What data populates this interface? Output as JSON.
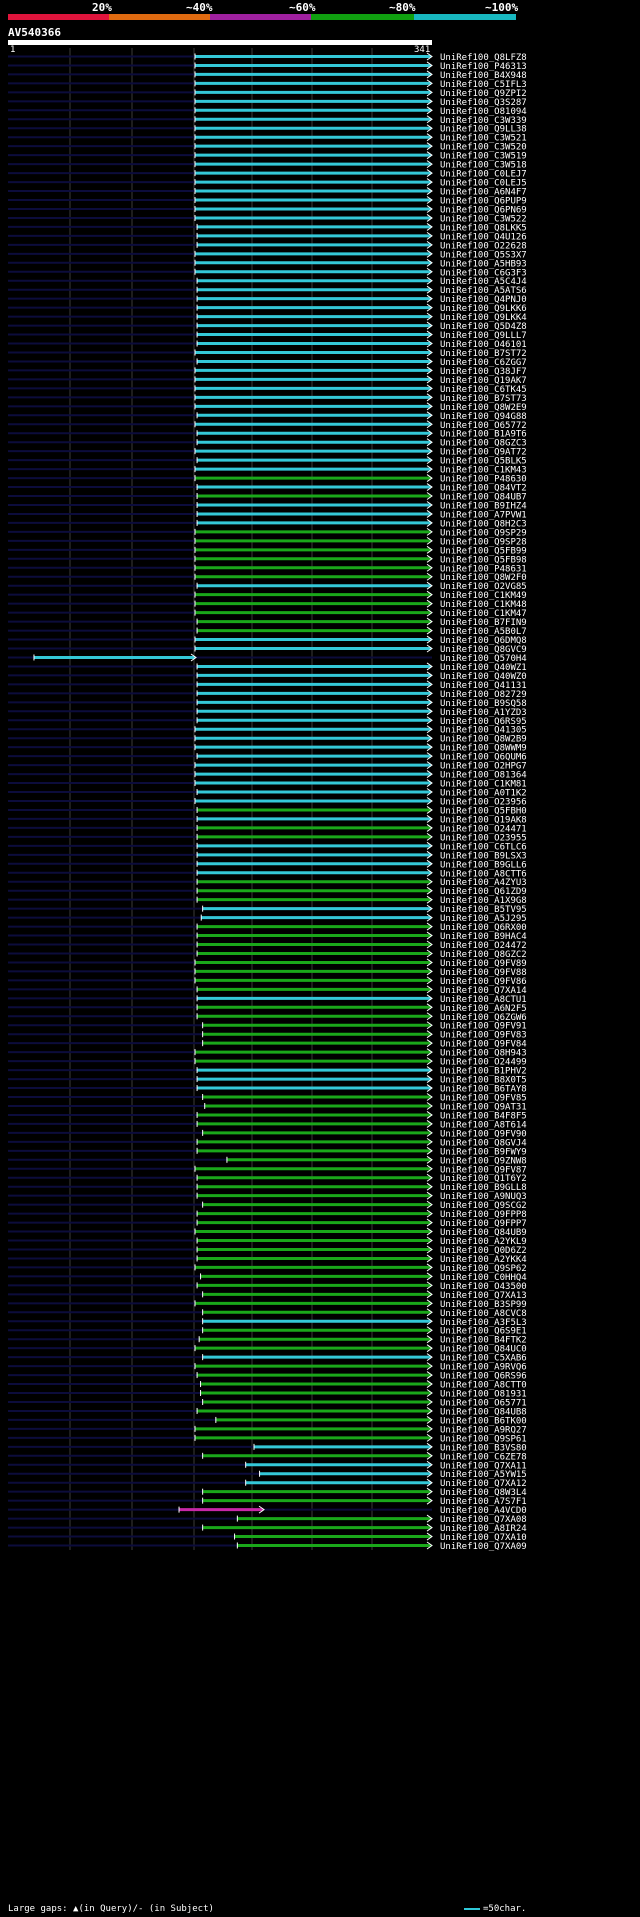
{
  "header": {
    "percent_labels": [
      "20%",
      "~40%",
      "~60%",
      "~80%",
      "~100%"
    ],
    "identity_colors": [
      "#e0143c",
      "#e06a10",
      "#a020a0",
      "#10a010",
      "#18b8c0"
    ],
    "query_id": "AV540366",
    "query_start_label": "1",
    "query_end_label": "341"
  },
  "footer": {
    "gaps_legend": "Large gaps: ▲(in Query)/- (in Subject)",
    "scale_label": "=50char."
  },
  "chart_data": {
    "type": "alignment",
    "query_length": 341,
    "colors": {
      "cyan": "#34c8d8",
      "green": "#1aa81a",
      "magenta": "#c828a8"
    },
    "hits": [
      {
        "id": "UniRef100_Q8LFZ8",
        "start": 1,
        "end": 341,
        "color": "cyan"
      },
      {
        "id": "UniRef100_P46313",
        "start": 1,
        "end": 341,
        "color": "cyan"
      },
      {
        "id": "UniRef100_B4X948",
        "start": 1,
        "end": 341,
        "color": "cyan"
      },
      {
        "id": "UniRef100_C5IFL3",
        "start": 1,
        "end": 341,
        "color": "cyan"
      },
      {
        "id": "UniRef100_Q9ZPI2",
        "start": 1,
        "end": 341,
        "color": "cyan"
      },
      {
        "id": "UniRef100_Q3S287",
        "start": 1,
        "end": 341,
        "color": "cyan"
      },
      {
        "id": "UniRef100_O81094",
        "start": 1,
        "end": 341,
        "color": "cyan"
      },
      {
        "id": "UniRef100_C3W339",
        "start": 1,
        "end": 341,
        "color": "cyan"
      },
      {
        "id": "UniRef100_Q9LL38",
        "start": 1,
        "end": 341,
        "color": "cyan"
      },
      {
        "id": "UniRef100_C3W521",
        "start": 1,
        "end": 341,
        "color": "cyan"
      },
      {
        "id": "UniRef100_C3W520",
        "start": 1,
        "end": 341,
        "color": "cyan"
      },
      {
        "id": "UniRef100_C3W519",
        "start": 1,
        "end": 341,
        "color": "cyan"
      },
      {
        "id": "UniRef100_C3W518",
        "start": 1,
        "end": 341,
        "color": "cyan"
      },
      {
        "id": "UniRef100_C0LEJ7",
        "start": 1,
        "end": 341,
        "color": "cyan"
      },
      {
        "id": "UniRef100_C0LEJ5",
        "start": 1,
        "end": 341,
        "color": "cyan"
      },
      {
        "id": "UniRef100_A6N4F7",
        "start": 1,
        "end": 341,
        "color": "cyan"
      },
      {
        "id": "UniRef100_Q6PUP9",
        "start": 1,
        "end": 341,
        "color": "cyan"
      },
      {
        "id": "UniRef100_Q6PN69",
        "start": 1,
        "end": 341,
        "color": "cyan"
      },
      {
        "id": "UniRef100_C3W522",
        "start": 1,
        "end": 341,
        "color": "cyan"
      },
      {
        "id": "UniRef100_Q8LKK5",
        "start": 4,
        "end": 341,
        "color": "cyan"
      },
      {
        "id": "UniRef100_Q4U126",
        "start": 4,
        "end": 341,
        "color": "cyan"
      },
      {
        "id": "UniRef100_O22628",
        "start": 4,
        "end": 341,
        "color": "cyan"
      },
      {
        "id": "UniRef100_Q5S3X7",
        "start": 1,
        "end": 341,
        "color": "cyan"
      },
      {
        "id": "UniRef100_A5HB93",
        "start": 1,
        "end": 341,
        "color": "cyan"
      },
      {
        "id": "UniRef100_C6G3F3",
        "start": 1,
        "end": 341,
        "color": "cyan"
      },
      {
        "id": "UniRef100_A5C4J4",
        "start": 4,
        "end": 341,
        "color": "cyan"
      },
      {
        "id": "UniRef100_A5ATS6",
        "start": 4,
        "end": 341,
        "color": "cyan"
      },
      {
        "id": "UniRef100_Q4PNJ0",
        "start": 4,
        "end": 341,
        "color": "cyan"
      },
      {
        "id": "UniRef100_Q9LKK6",
        "start": 4,
        "end": 341,
        "color": "cyan"
      },
      {
        "id": "UniRef100_Q9LKK4",
        "start": 4,
        "end": 341,
        "color": "cyan"
      },
      {
        "id": "UniRef100_Q5D4Z8",
        "start": 4,
        "end": 341,
        "color": "cyan"
      },
      {
        "id": "UniRef100_Q9LLL7",
        "start": 4,
        "end": 341,
        "color": "cyan"
      },
      {
        "id": "UniRef100_O46101",
        "start": 4,
        "end": 341,
        "color": "cyan"
      },
      {
        "id": "UniRef100_B7ST72",
        "start": 1,
        "end": 341,
        "color": "cyan"
      },
      {
        "id": "UniRef100_C6ZGG7",
        "start": 4,
        "end": 341,
        "color": "cyan"
      },
      {
        "id": "UniRef100_Q38JF7",
        "start": 1,
        "end": 341,
        "color": "cyan"
      },
      {
        "id": "UniRef100_Q19AK7",
        "start": 1,
        "end": 341,
        "color": "cyan"
      },
      {
        "id": "UniRef100_C6TK45",
        "start": 1,
        "end": 341,
        "color": "cyan"
      },
      {
        "id": "UniRef100_B7ST73",
        "start": 1,
        "end": 341,
        "color": "cyan"
      },
      {
        "id": "UniRef100_Q8W2E9",
        "start": 1,
        "end": 341,
        "color": "cyan"
      },
      {
        "id": "UniRef100_Q94G88",
        "start": 4,
        "end": 341,
        "color": "cyan"
      },
      {
        "id": "UniRef100_O65772",
        "start": 1,
        "end": 341,
        "color": "cyan"
      },
      {
        "id": "UniRef100_B1A9T6",
        "start": 4,
        "end": 341,
        "color": "cyan"
      },
      {
        "id": "UniRef100_Q8GZC3",
        "start": 4,
        "end": 341,
        "color": "cyan"
      },
      {
        "id": "UniRef100_Q9AT72",
        "start": 1,
        "end": 341,
        "color": "cyan"
      },
      {
        "id": "UniRef100_Q5BLK5",
        "start": 4,
        "end": 341,
        "color": "cyan"
      },
      {
        "id": "UniRef100_C1KM43",
        "start": 1,
        "end": 341,
        "color": "cyan"
      },
      {
        "id": "UniRef100_P48630",
        "start": 1,
        "end": 341,
        "color": "green"
      },
      {
        "id": "UniRef100_Q84VT2",
        "start": 4,
        "end": 341,
        "color": "cyan"
      },
      {
        "id": "UniRef100_Q84UB7",
        "start": 4,
        "end": 341,
        "color": "green"
      },
      {
        "id": "UniRef100_B9IHZ4",
        "start": 4,
        "end": 341,
        "color": "cyan"
      },
      {
        "id": "UniRef100_A7PVW1",
        "start": 4,
        "end": 341,
        "color": "cyan"
      },
      {
        "id": "UniRef100_Q8H2C3",
        "start": 4,
        "end": 341,
        "color": "cyan"
      },
      {
        "id": "UniRef100_Q9SP29",
        "start": 1,
        "end": 341,
        "color": "green"
      },
      {
        "id": "UniRef100_Q9SP28",
        "start": 1,
        "end": 341,
        "color": "green"
      },
      {
        "id": "UniRef100_Q5FB99",
        "start": 1,
        "end": 341,
        "color": "green"
      },
      {
        "id": "UniRef100_Q5FB98",
        "start": 1,
        "end": 341,
        "color": "green"
      },
      {
        "id": "UniRef100_P48631",
        "start": 1,
        "end": 341,
        "color": "green"
      },
      {
        "id": "UniRef100_Q8W2F0",
        "start": 1,
        "end": 341,
        "color": "green"
      },
      {
        "id": "UniRef100_O2VG85",
        "start": 4,
        "end": 341,
        "color": "cyan"
      },
      {
        "id": "UniRef100_C1KM49",
        "start": 1,
        "end": 341,
        "color": "green"
      },
      {
        "id": "UniRef100_C1KM48",
        "start": 1,
        "end": 341,
        "color": "green"
      },
      {
        "id": "UniRef100_C1KM47",
        "start": 1,
        "end": 341,
        "color": "green"
      },
      {
        "id": "UniRef100_B7FIN9",
        "start": 4,
        "end": 341,
        "color": "green"
      },
      {
        "id": "UniRef100_A5B0L7",
        "start": 4,
        "end": 341,
        "color": "green"
      },
      {
        "id": "UniRef100_Q6DMQ8",
        "start": 1,
        "end": 341,
        "color": "cyan"
      },
      {
        "id": "UniRef100_Q8GVC9",
        "start": 1,
        "end": 341,
        "color": "cyan"
      },
      {
        "id": "UniRef100_Q570H4",
        "start": -231,
        "end": 1,
        "color": "cyan"
      },
      {
        "id": "UniRef100_Q40WZ1",
        "start": 4,
        "end": 341,
        "color": "cyan"
      },
      {
        "id": "UniRef100_Q40WZ0",
        "start": 4,
        "end": 341,
        "color": "cyan"
      },
      {
        "id": "UniRef100_Q41131",
        "start": 4,
        "end": 341,
        "color": "cyan"
      },
      {
        "id": "UniRef100_O82729",
        "start": 4,
        "end": 341,
        "color": "cyan"
      },
      {
        "id": "UniRef100_B9SQ58",
        "start": 4,
        "end": 341,
        "color": "cyan"
      },
      {
        "id": "UniRef100_A1YZD3",
        "start": 4,
        "end": 341,
        "color": "cyan"
      },
      {
        "id": "UniRef100_Q6RS95",
        "start": 4,
        "end": 341,
        "color": "cyan"
      },
      {
        "id": "UniRef100_Q41305",
        "start": 1,
        "end": 341,
        "color": "cyan"
      },
      {
        "id": "UniRef100_Q8W2B9",
        "start": 1,
        "end": 341,
        "color": "cyan"
      },
      {
        "id": "UniRef100_Q8WWM9",
        "start": 1,
        "end": 341,
        "color": "cyan"
      },
      {
        "id": "UniRef100_Q6QUM6",
        "start": 4,
        "end": 341,
        "color": "cyan"
      },
      {
        "id": "UniRef100_O2HPG7",
        "start": 1,
        "end": 341,
        "color": "cyan"
      },
      {
        "id": "UniRef100_O81364",
        "start": 1,
        "end": 341,
        "color": "cyan"
      },
      {
        "id": "UniRef100_C1KM81",
        "start": 1,
        "end": 341,
        "color": "cyan"
      },
      {
        "id": "UniRef100_A0T1K2",
        "start": 4,
        "end": 341,
        "color": "cyan"
      },
      {
        "id": "UniRef100_O23956",
        "start": 1,
        "end": 341,
        "color": "cyan"
      },
      {
        "id": "UniRef100_Q5FBH0",
        "start": 4,
        "end": 341,
        "color": "green"
      },
      {
        "id": "UniRef100_Q19AK8",
        "start": 4,
        "end": 341,
        "color": "cyan"
      },
      {
        "id": "UniRef100_O24471",
        "start": 4,
        "end": 341,
        "color": "green"
      },
      {
        "id": "UniRef100_O23955",
        "start": 4,
        "end": 341,
        "color": "green"
      },
      {
        "id": "UniRef100_C6TLC6",
        "start": 4,
        "end": 341,
        "color": "cyan"
      },
      {
        "id": "UniRef100_B9LSX3",
        "start": 4,
        "end": 341,
        "color": "cyan"
      },
      {
        "id": "UniRef100_B9GLL6",
        "start": 4,
        "end": 341,
        "color": "cyan"
      },
      {
        "id": "UniRef100_A8CTT6",
        "start": 4,
        "end": 341,
        "color": "cyan"
      },
      {
        "id": "UniRef100_A4ZYU3",
        "start": 4,
        "end": 341,
        "color": "green"
      },
      {
        "id": "UniRef100_Q61ZD9",
        "start": 4,
        "end": 341,
        "color": "green"
      },
      {
        "id": "UniRef100_A1X9G8",
        "start": 4,
        "end": 341,
        "color": "green"
      },
      {
        "id": "UniRef100_B5TV95",
        "start": 12,
        "end": 341,
        "color": "cyan"
      },
      {
        "id": "UniRef100_A5J295",
        "start": 10,
        "end": 341,
        "color": "cyan"
      },
      {
        "id": "UniRef100_Q6RX00",
        "start": 4,
        "end": 341,
        "color": "green"
      },
      {
        "id": "UniRef100_B9HAC4",
        "start": 4,
        "end": 341,
        "color": "green"
      },
      {
        "id": "UniRef100_O24472",
        "start": 4,
        "end": 341,
        "color": "green"
      },
      {
        "id": "UniRef100_Q8GZC2",
        "start": 4,
        "end": 341,
        "color": "green"
      },
      {
        "id": "UniRef100_Q9FV89",
        "start": 1,
        "end": 341,
        "color": "green"
      },
      {
        "id": "UniRef100_Q9FV88",
        "start": 1,
        "end": 341,
        "color": "green"
      },
      {
        "id": "UniRef100_Q9FV86",
        "start": 1,
        "end": 341,
        "color": "green"
      },
      {
        "id": "UniRef100_Q7XA14",
        "start": 4,
        "end": 341,
        "color": "green"
      },
      {
        "id": "UniRef100_A8CTU1",
        "start": 4,
        "end": 341,
        "color": "cyan"
      },
      {
        "id": "UniRef100_A6N2F5",
        "start": 4,
        "end": 341,
        "color": "green"
      },
      {
        "id": "UniRef100_Q6ZGW6",
        "start": 4,
        "end": 341,
        "color": "green"
      },
      {
        "id": "UniRef100_Q9FV91",
        "start": 12,
        "end": 341,
        "color": "green"
      },
      {
        "id": "UniRef100_Q9FV83",
        "start": 12,
        "end": 341,
        "color": "green"
      },
      {
        "id": "UniRef100_Q9FV84",
        "start": 12,
        "end": 341,
        "color": "green"
      },
      {
        "id": "UniRef100_Q8H943",
        "start": 1,
        "end": 341,
        "color": "green"
      },
      {
        "id": "UniRef100_O24499",
        "start": 1,
        "end": 341,
        "color": "green"
      },
      {
        "id": "UniRef100_B1PHV2",
        "start": 4,
        "end": 341,
        "color": "cyan"
      },
      {
        "id": "UniRef100_B8X0T5",
        "start": 4,
        "end": 341,
        "color": "cyan"
      },
      {
        "id": "UniRef100_B6TAY8",
        "start": 4,
        "end": 341,
        "color": "cyan"
      },
      {
        "id": "UniRef100_Q9FV85",
        "start": 12,
        "end": 341,
        "color": "green"
      },
      {
        "id": "UniRef100_Q9AT31",
        "start": 15,
        "end": 341,
        "color": "green"
      },
      {
        "id": "UniRef100_B4F8F5",
        "start": 4,
        "end": 341,
        "color": "green"
      },
      {
        "id": "UniRef100_A8T614",
        "start": 4,
        "end": 341,
        "color": "green"
      },
      {
        "id": "UniRef100_Q9FV90",
        "start": 12,
        "end": 341,
        "color": "green"
      },
      {
        "id": "UniRef100_Q8GVJ4",
        "start": 4,
        "end": 341,
        "color": "green"
      },
      {
        "id": "UniRef100_B9FWY9",
        "start": 4,
        "end": 341,
        "color": "green"
      },
      {
        "id": "UniRef100_Q9ZNW8",
        "start": 47,
        "end": 341,
        "color": "green"
      },
      {
        "id": "UniRef100_Q9FV87",
        "start": 1,
        "end": 341,
        "color": "green"
      },
      {
        "id": "UniRef100_Q1T6Y2",
        "start": 4,
        "end": 341,
        "color": "green"
      },
      {
        "id": "UniRef100_B9GLL8",
        "start": 4,
        "end": 341,
        "color": "green"
      },
      {
        "id": "UniRef100_A9NUQ3",
        "start": 4,
        "end": 341,
        "color": "green"
      },
      {
        "id": "UniRef100_Q9SCG2",
        "start": 12,
        "end": 341,
        "color": "green"
      },
      {
        "id": "UniRef100_Q9FPP8",
        "start": 4,
        "end": 341,
        "color": "green"
      },
      {
        "id": "UniRef100_Q9FPP7",
        "start": 4,
        "end": 341,
        "color": "green"
      },
      {
        "id": "UniRef100_Q84UB9",
        "start": 1,
        "end": 341,
        "color": "green"
      },
      {
        "id": "UniRef100_A2YKL9",
        "start": 4,
        "end": 341,
        "color": "green"
      },
      {
        "id": "UniRef100_Q0D6Z2",
        "start": 4,
        "end": 341,
        "color": "green"
      },
      {
        "id": "UniRef100_A2YKK4",
        "start": 4,
        "end": 341,
        "color": "green"
      },
      {
        "id": "UniRef100_Q9SP62",
        "start": 1,
        "end": 341,
        "color": "green"
      },
      {
        "id": "UniRef100_C0HHQ4",
        "start": 9,
        "end": 341,
        "color": "green"
      },
      {
        "id": "UniRef100_O43500",
        "start": 4,
        "end": 341,
        "color": "green"
      },
      {
        "id": "UniRef100_Q7XA13",
        "start": 12,
        "end": 341,
        "color": "green"
      },
      {
        "id": "UniRef100_B3SP99",
        "start": 1,
        "end": 341,
        "color": "green"
      },
      {
        "id": "UniRef100_A8CVC8",
        "start": 12,
        "end": 341,
        "color": "green"
      },
      {
        "id": "UniRef100_A3F5L3",
        "start": 12,
        "end": 341,
        "color": "cyan"
      },
      {
        "id": "UniRef100_Q6S9E1",
        "start": 12,
        "end": 341,
        "color": "green"
      },
      {
        "id": "UniRef100_B4FTK2",
        "start": 7,
        "end": 341,
        "color": "green"
      },
      {
        "id": "UniRef100_Q84UC0",
        "start": 1,
        "end": 341,
        "color": "green"
      },
      {
        "id": "UniRef100_C5XAB6",
        "start": 12,
        "end": 341,
        "color": "cyan"
      },
      {
        "id": "UniRef100_A9RVQ6",
        "start": 1,
        "end": 341,
        "color": "green"
      },
      {
        "id": "UniRef100_Q6RS96",
        "start": 4,
        "end": 341,
        "color": "green"
      },
      {
        "id": "UniRef100_A8CTT0",
        "start": 9,
        "end": 341,
        "color": "green"
      },
      {
        "id": "UniRef100_O81931",
        "start": 9,
        "end": 341,
        "color": "green"
      },
      {
        "id": "UniRef100_O65771",
        "start": 12,
        "end": 341,
        "color": "green"
      },
      {
        "id": "UniRef100_Q84UB8",
        "start": 4,
        "end": 341,
        "color": "green"
      },
      {
        "id": "UniRef100_B6TK00",
        "start": 31,
        "end": 341,
        "color": "green"
      },
      {
        "id": "UniRef100_A9RQ27",
        "start": 1,
        "end": 341,
        "color": "green"
      },
      {
        "id": "UniRef100_Q9SP61",
        "start": 1,
        "end": 341,
        "color": "green"
      },
      {
        "id": "UniRef100_B3VS80",
        "start": 86,
        "end": 341,
        "color": "cyan"
      },
      {
        "id": "UniRef100_C6ZE78",
        "start": 12,
        "end": 341,
        "color": "green"
      },
      {
        "id": "UniRef100_Q7XA11",
        "start": 74,
        "end": 341,
        "color": "cyan"
      },
      {
        "id": "UniRef100_A5YW15",
        "start": 94,
        "end": 341,
        "color": "cyan"
      },
      {
        "id": "UniRef100_Q7XA12",
        "start": 74,
        "end": 341,
        "color": "cyan"
      },
      {
        "id": "UniRef100_Q8W3L4",
        "start": 12,
        "end": 341,
        "color": "green"
      },
      {
        "id": "UniRef100_A7S7F1",
        "start": 12,
        "end": 341,
        "color": "green"
      },
      {
        "id": "UniRef100_A4VCD0",
        "start": -22,
        "end": 99,
        "color": "magenta"
      },
      {
        "id": "UniRef100_Q7XA08",
        "start": 62,
        "end": 341,
        "color": "green"
      },
      {
        "id": "UniRef100_A8IR24",
        "start": 12,
        "end": 341,
        "color": "green"
      },
      {
        "id": "UniRef100_Q7XA10",
        "start": 58,
        "end": 341,
        "color": "green"
      },
      {
        "id": "UniRef100_Q7XA09",
        "start": 62,
        "end": 341,
        "color": "green"
      }
    ]
  }
}
